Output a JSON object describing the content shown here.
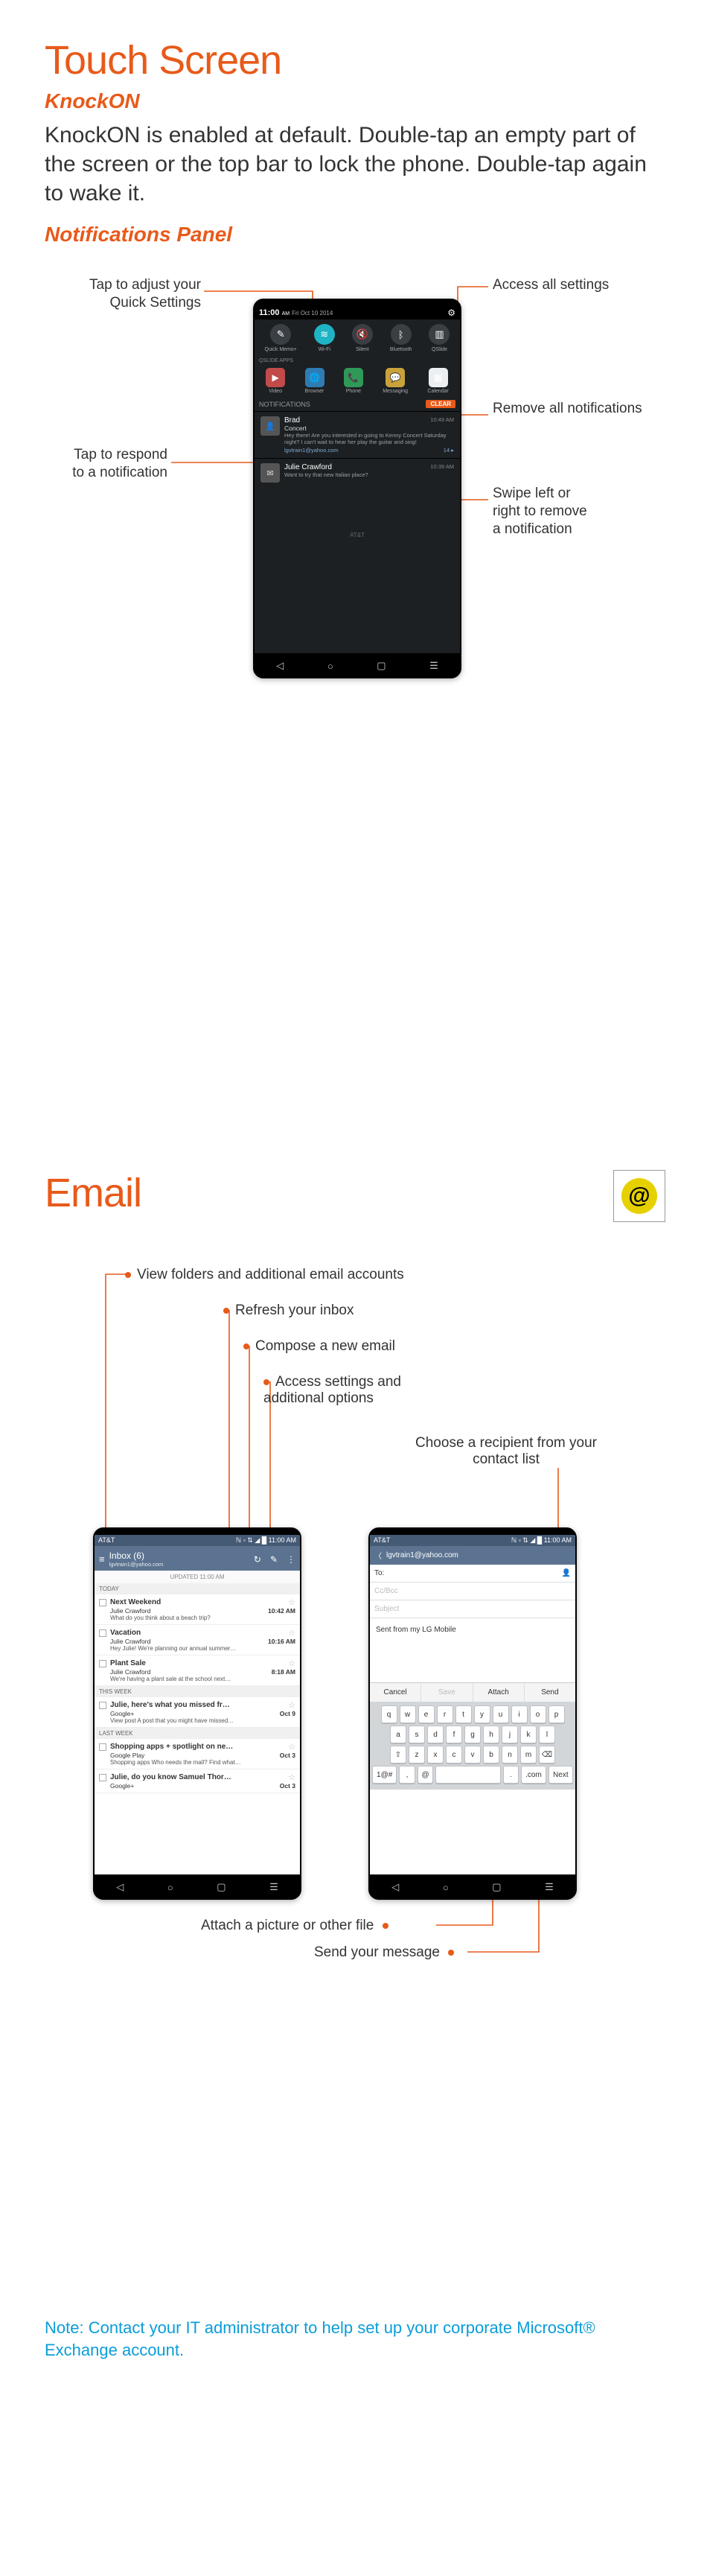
{
  "section1": {
    "title": "Touch Screen",
    "sub": "KnockON",
    "body": "KnockON is enabled at default. Double-tap an empty part of the screen or the top bar to lock the phone. Double-tap again to wake it.",
    "sub2": "Notifications Panel",
    "callouts": {
      "qs": "Tap to adjust your Quick Settings",
      "settings": "Access all settings",
      "clear": "Remove all notifications",
      "respond": "Tap to respond to a notification",
      "swipe": "Swipe left or right to remove a notification"
    },
    "phone": {
      "time": "11:00",
      "ampm": "AM",
      "date": "Fri Oct 10 2014",
      "qs": [
        {
          "label": "Quick Memo+",
          "icon": "✎"
        },
        {
          "label": "Wi-Fi",
          "icon": "≋",
          "active": true
        },
        {
          "label": "Silent",
          "icon": "🔇"
        },
        {
          "label": "Bluetooth",
          "icon": "ᛒ"
        },
        {
          "label": "QSlide",
          "icon": "▥"
        }
      ],
      "appsLabel": "QSLIDE APPS",
      "apps": [
        {
          "label": "Video",
          "icon": "▶",
          "bg": "#c24a4a"
        },
        {
          "label": "Browser",
          "icon": "🌐",
          "bg": "#2e7cb3"
        },
        {
          "label": "Phone",
          "icon": "📞",
          "bg": "#2f9a57"
        },
        {
          "label": "Messaging",
          "icon": "💬",
          "bg": "#caa23a"
        },
        {
          "label": "Calendar",
          "icon": "▦",
          "bg": "#eceff2"
        }
      ],
      "notifHeader": "NOTIFICATIONS",
      "clear": "CLEAR",
      "items": [
        {
          "title": "Brad",
          "time": "10:49 AM",
          "sub": "Concert",
          "body": "Hey there! Are you interested in going to Kenny Concert Saturday night? I can't wait to hear her play the guitar and sing!",
          "link": "lgvtrain1@yahoo.com",
          "count": "14"
        },
        {
          "title": "Julie Crawford",
          "time": "10:39 AM",
          "body": "Want to try that new Italian place?"
        }
      ],
      "carrier": "AT&T",
      "nav": [
        "◁",
        "○",
        "▢",
        "☰"
      ]
    }
  },
  "section2": {
    "title": "Email",
    "labels": {
      "folders": "View folders and additional email accounts",
      "refresh": "Refresh your inbox",
      "compose": "Compose a new email",
      "options": "Access settings and additional options",
      "recipient": "Choose a recipient from your contact list",
      "attach": "Attach a picture or other file",
      "send": "Send your message"
    },
    "inbox": {
      "carrier": "AT&T",
      "sigtime": "11:00 AM",
      "title": "Inbox (6)",
      "account": "lgvtrain1@yahoo.com",
      "updated": "UPDATED 11:00 AM",
      "groups": [
        {
          "hdr": "TODAY",
          "rows": [
            {
              "subj": "Next Weekend",
              "from": "Julie Crawford",
              "time": "10:42 AM",
              "preview": "What do you think about a beach trip?"
            },
            {
              "subj": "Vacation",
              "from": "Julie Crawford",
              "time": "10:16 AM",
              "preview": "Hey Julie! We're planning our annual summer…"
            },
            {
              "subj": "Plant Sale",
              "from": "Julie Crawford",
              "time": "8:18 AM",
              "preview": "We're having a plant sale at the school next…"
            }
          ]
        },
        {
          "hdr": "THIS WEEK",
          "rows": [
            {
              "subj": "Julie, here's what you missed fr…",
              "from": "Google+",
              "time": "Oct 9",
              "preview": "View post A post that you might have missed…"
            }
          ]
        },
        {
          "hdr": "LAST WEEK",
          "rows": [
            {
              "subj": "Shopping apps + spotlight on ne…",
              "from": "Google Play",
              "time": "Oct 3",
              "preview": "Shopping apps Who needs the mall? Find what…"
            },
            {
              "subj": "Julie, do you know Samuel Thor…",
              "from": "Google+",
              "time": "Oct 3",
              "preview": ""
            }
          ]
        }
      ]
    },
    "compose": {
      "carrier": "AT&T",
      "sigtime": "11:00 AM",
      "account": "lgvtrain1@yahoo.com",
      "to": "To:",
      "cc": "Cc/Bcc",
      "subject": "Subject",
      "body": "Sent from my LG Mobile",
      "buttons": {
        "cancel": "Cancel",
        "save": "Save",
        "attach": "Attach",
        "send": "Send"
      },
      "kb": {
        "r1": [
          "q",
          "w",
          "e",
          "r",
          "t",
          "y",
          "u",
          "i",
          "o",
          "p"
        ],
        "r2": [
          "a",
          "s",
          "d",
          "f",
          "g",
          "h",
          "j",
          "k",
          "l"
        ],
        "r3": [
          "⇧",
          "z",
          "x",
          "c",
          "v",
          "b",
          "n",
          "m",
          "⌫"
        ],
        "r4": {
          "sym": "1@#",
          "comma": ",",
          "at": "@",
          ".": ".",
          "com": ".com",
          "next": "Next"
        }
      }
    }
  },
  "note": "Note: Contact your IT administrator to help set up your corporate Microsoft® Exchange account."
}
